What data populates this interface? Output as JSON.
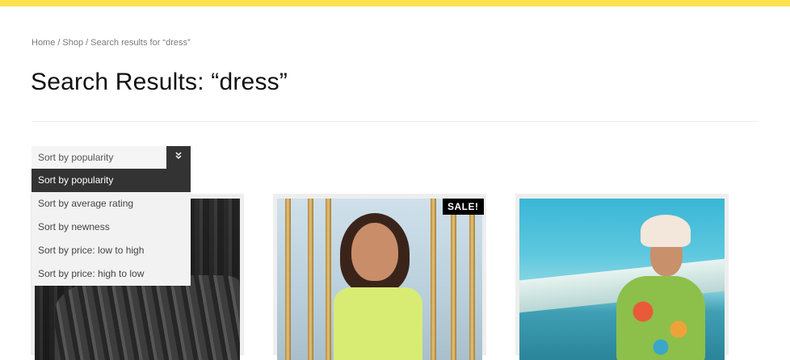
{
  "colors": {
    "topbar": "#ffe14d",
    "dropdown_selected_bg": "#333333",
    "sale_badge_bg": "#000000"
  },
  "breadcrumb": {
    "home": "Home",
    "shop": "Shop",
    "current": "Search results for “dress”",
    "separator": "/"
  },
  "page_title": "Search Results: “dress”",
  "sort": {
    "selected_value": "Sort by popularity",
    "arrow_icon": "double-chevron-down-icon",
    "options": [
      {
        "label": "Sort by popularity",
        "selected": true
      },
      {
        "label": "Sort by average rating",
        "selected": false
      },
      {
        "label": "Sort by newness",
        "selected": false
      },
      {
        "label": "Sort by price: low to high",
        "selected": false
      },
      {
        "label": "Sort by price: high to low",
        "selected": false
      }
    ]
  },
  "products": [
    {
      "sale": false
    },
    {
      "sale": true,
      "badge_label": "SALE!"
    },
    {
      "sale": false
    }
  ]
}
